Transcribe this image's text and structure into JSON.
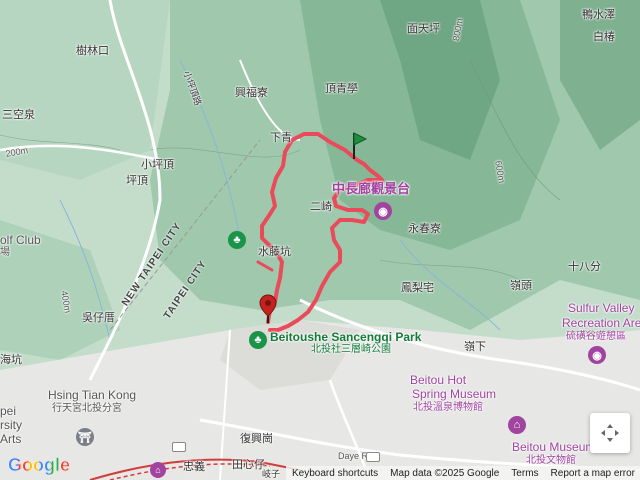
{
  "map": {
    "labels": {
      "mianTianPing": "面天坪",
      "yaShuiZe": "鴨水澤",
      "baiHu": "白椿",
      "shuLinKou": "樹林口",
      "xingFuLiao": "興福寮",
      "dingQingXue": "頂青學",
      "sanKongQuan": "三空泉",
      "xiaoPingDing": "小坪頂",
      "pingDing": "坪頂",
      "xiaPing": "下青",
      "erTing": "二崎",
      "yongChunLiao": "永春寮",
      "shiBaFen": "十八分",
      "lingTou": "嶺頭",
      "shuiTengKeng": "水藤坑",
      "fengLiZhai": "鳳梨宅",
      "wuZiCuo": "吳仔厝",
      "lingXia": "嶺下",
      "haiKeng": "海坑",
      "fuXingGang": "復興崗",
      "tianXinZi": "田心仔",
      "zhongYi": "忠義",
      "qiZi": "岐子",
      "xiaoPingRoad": "小坪頂路",
      "golfClub": "olf Club",
      "golfClubSub": "場"
    },
    "roads": {
      "dayeRd": "Daye Rd"
    },
    "contours": {
      "c200a": "200m",
      "c400a": "400m",
      "c600a": "600m",
      "c800a": "800m",
      "c200b": "200m"
    },
    "cities": {
      "newTaipei": "NEW TAIPEI CITY",
      "taipei": "TAIPEI CITY"
    },
    "pois": {
      "viewpoint": "中長廊觀景台",
      "sulfurValley": "Sulfur Valley",
      "sulfurValleySub": "Recreation Area",
      "sulfurValleyZh": "硫磺谷遊憩區",
      "sancengqiPark": "Beitoushe Sancengqi Park",
      "sancengqiParkZh": "北投社三層崎公園",
      "hotSpring": "Beitou Hot",
      "hotSpringSub": "Spring Museum",
      "hotSpringZh": "北投溫泉博物館",
      "beitouMuseum": "Beitou Museum",
      "beitouMuseumZh": "北投文物館",
      "xingtian": "Hsing Tian Kong",
      "xingtianZh": "行天宮北投分宮",
      "university1": "pei",
      "university2": "rsity",
      "university3": "Arts"
    },
    "footer": {
      "logo": "Google",
      "keyboard": "Keyboard shortcuts",
      "mapData": "Map data ©2025 Google",
      "terms": "Terms",
      "report": "Report a map error"
    },
    "colors": {
      "route": "#ea4b5a",
      "startFlag": "#1e8e3e",
      "endPin": "#c5221f",
      "poiPurple": "#a1449f",
      "poiGreen": "#1a9448"
    }
  }
}
